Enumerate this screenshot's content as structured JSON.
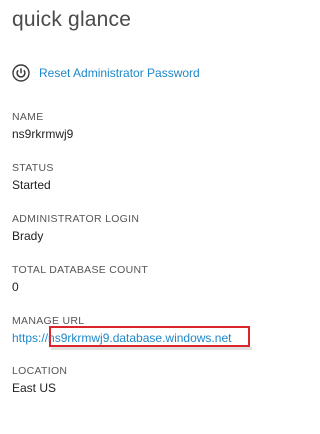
{
  "panel": {
    "title": "quick glance"
  },
  "actions": {
    "reset_label": "Reset Administrator Password",
    "reset_icon": "power-reset-icon"
  },
  "fields": {
    "name": {
      "label": "NAME",
      "value": "ns9rkrmwj9"
    },
    "status": {
      "label": "STATUS",
      "value": "Started"
    },
    "admin_login": {
      "label": "ADMINISTRATOR LOGIN",
      "value": "Brady"
    },
    "db_count": {
      "label": "TOTAL DATABASE COUNT",
      "value": "0"
    },
    "manage_url": {
      "label": "MANAGE URL",
      "prefix": "https:",
      "host": "//ns9rkrmwj9.database.windows.net"
    },
    "location": {
      "label": "LOCATION",
      "value": "East US"
    }
  },
  "colors": {
    "link": "#1e88c8",
    "highlight": "#d9252b"
  }
}
